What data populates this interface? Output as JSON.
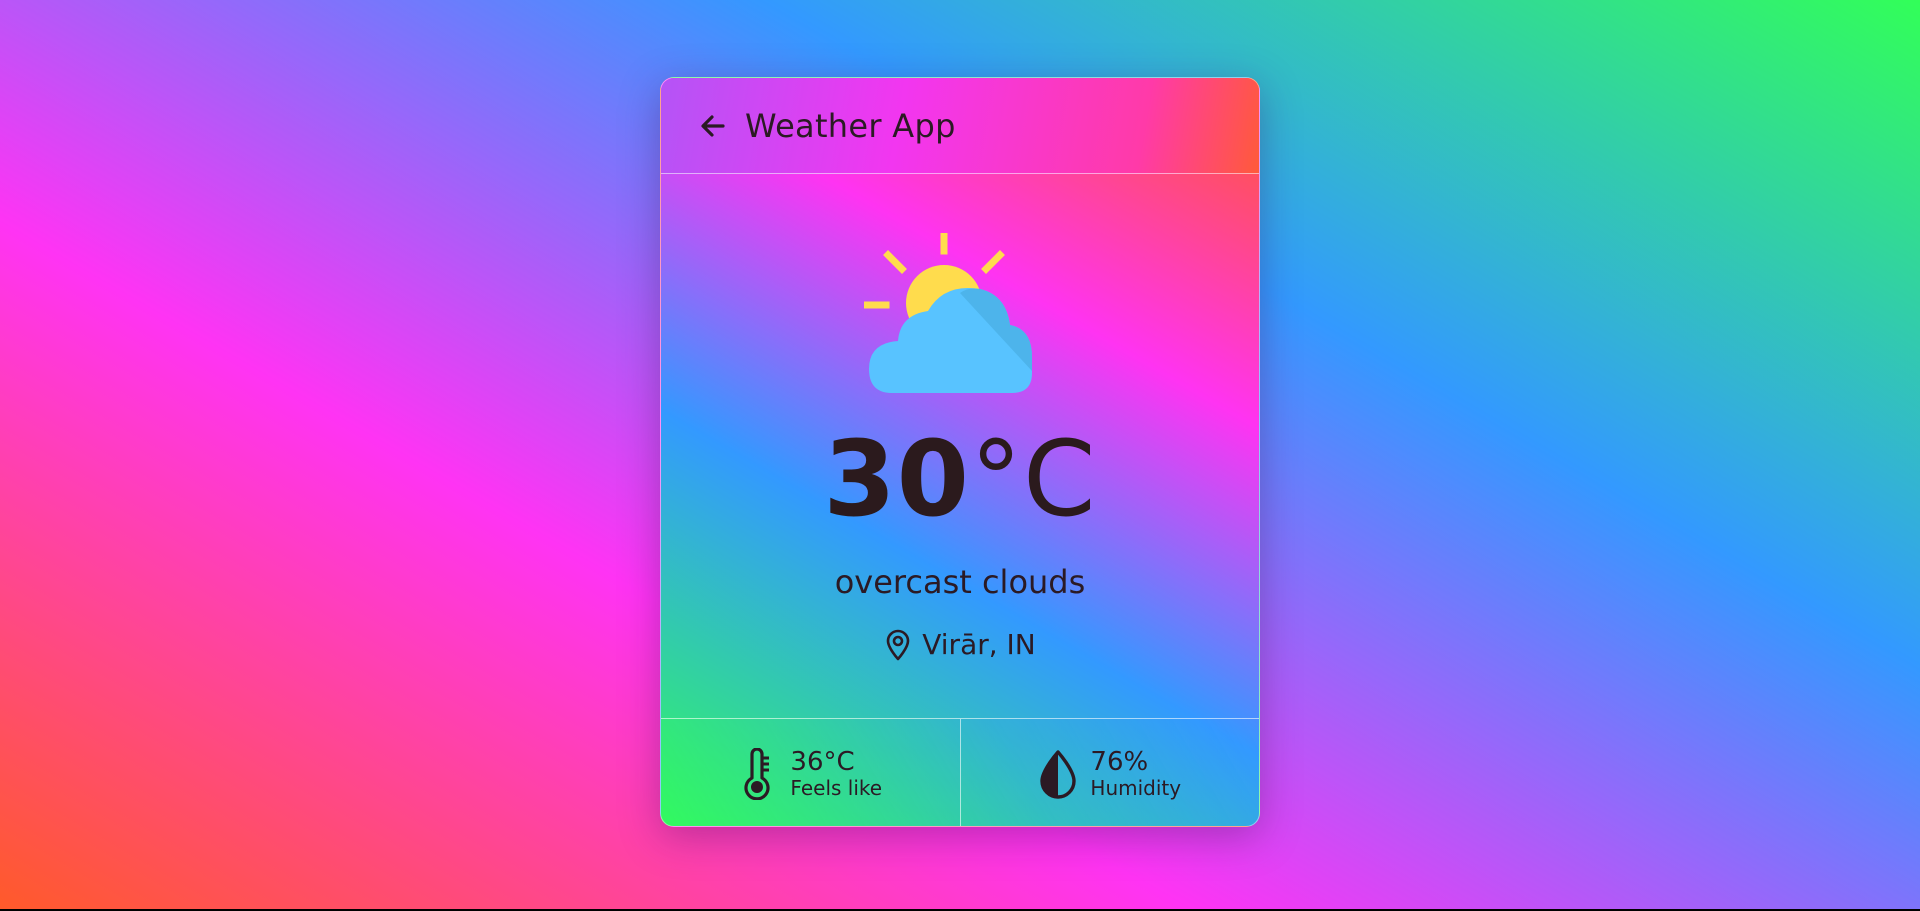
{
  "header": {
    "title": "Weather App",
    "back_icon": "arrow-left-icon"
  },
  "weather": {
    "icon": "partly-cloudy-icon",
    "temperature_value": "30",
    "temperature_unit": "°C",
    "condition": "overcast clouds",
    "location_icon": "map-pin-icon",
    "location": "Virār, IN"
  },
  "stats": {
    "feels_like": {
      "icon": "thermometer-icon",
      "value": "36°C",
      "label": "Feels like"
    },
    "humidity": {
      "icon": "humidity-drop-icon",
      "value": "76%",
      "label": "Humidity"
    }
  },
  "colors": {
    "text": "#2b1a24",
    "sun": "#ffdc4d",
    "cloud": "#58c3ff",
    "cloud_shade": "#4bb2e8"
  }
}
